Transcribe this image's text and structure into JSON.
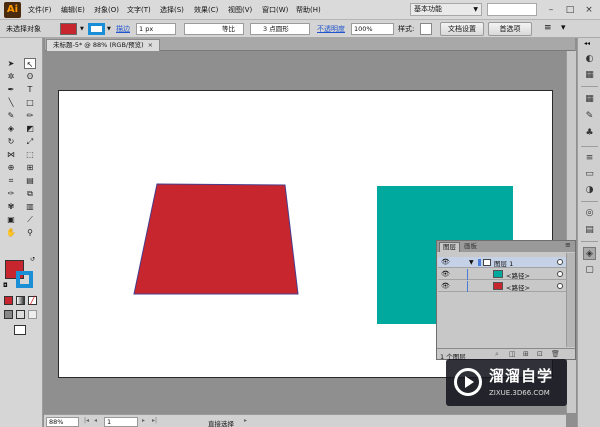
{
  "app": {
    "logo_text": "Ai"
  },
  "menu": [
    "文件(F)",
    "编辑(E)",
    "对象(O)",
    "文字(T)",
    "选择(S)",
    "效果(C)",
    "视图(V)",
    "窗口(W)",
    "帮助(H)"
  ],
  "workspace": {
    "label": "基本功能"
  },
  "controlbar": {
    "selection_status": "未选择对象",
    "stroke_label": "描边",
    "stroke_weight": "1 px",
    "profile": "等比",
    "brush": "3 点圆形",
    "opacity_label": "不透明度",
    "opacity_value": "100%",
    "style_label": "样式:",
    "doc_setup_button": "文档设置",
    "prefs_button": "首选项"
  },
  "document": {
    "tab_title": "未标题-5* @ 88% (RGB/预览)",
    "close": "×"
  },
  "statusbar": {
    "zoom": "88%",
    "page": "1",
    "tool_name": "直接选择"
  },
  "layers_panel": {
    "tabs": [
      "图层",
      "画板"
    ],
    "layer_name": "图层 1",
    "sublayers": [
      "<路径>",
      "<路径>"
    ],
    "footer_count": "1 个图层"
  },
  "colors": {
    "red_fill": "#c7262e",
    "teal_fill": "#00a99d",
    "fill_swatch": "#c7262e",
    "stroke_swatch": "#1a8fd6",
    "layer_color": "#4a7bd6"
  },
  "watermark": {
    "main_text": "溜溜自学",
    "sub_text": "ZIXUE.3D66.COM"
  }
}
